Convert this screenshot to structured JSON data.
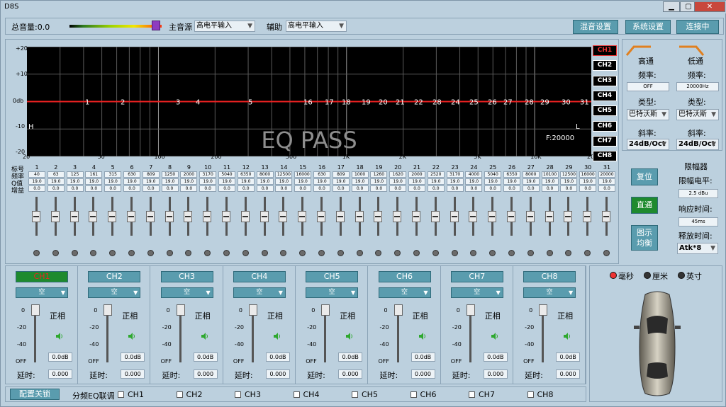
{
  "window": {
    "title": "D8S",
    "min": "▁",
    "max": "▢",
    "close": "✕"
  },
  "top": {
    "master_volume_label": "总音量:0.0",
    "main_source_label": "主音源",
    "main_source_value": "高电平输入",
    "aux_label": "辅助",
    "aux_value": "高电平输入",
    "buttons": [
      "混音设置",
      "系统设置",
      "连接中"
    ]
  },
  "eq": {
    "y_labels": [
      "+20",
      "+10",
      "0db",
      "-10",
      "-20"
    ],
    "x_labels": [
      "20",
      "50",
      "100",
      "200",
      "500",
      "1K",
      "2K",
      "5K",
      "10K",
      "20K"
    ],
    "band_markers": [
      "1",
      "2",
      "3",
      "4",
      "5",
      "16",
      "17",
      "18",
      "19",
      "20",
      "21",
      "22",
      "28",
      "24",
      "25",
      "26",
      "27",
      "28",
      "29",
      "30",
      "31"
    ],
    "overlay_text": "EQ PASS",
    "freq_readout": "F:20000",
    "h_marker": "H",
    "l_marker": "L",
    "channel_buttons": [
      "CH1",
      "CH2",
      "CH3",
      "CH4",
      "CH5",
      "CH6",
      "CH7",
      "CH8"
    ],
    "active_channel": "CH1"
  },
  "bands": {
    "row_labels": [
      "标号",
      "频率",
      "Q值",
      "增益"
    ],
    "numbers": [
      "1",
      "2",
      "3",
      "4",
      "5",
      "6",
      "7",
      "8",
      "9",
      "10",
      "11",
      "12",
      "13",
      "14",
      "15",
      "16",
      "17",
      "18",
      "19",
      "20",
      "21",
      "22",
      "23",
      "24",
      "25",
      "26",
      "27",
      "28",
      "29",
      "30",
      "31"
    ],
    "freqs": [
      "40",
      "63",
      "125",
      "161",
      "315",
      "630",
      "809",
      "1250",
      "2000",
      "3170",
      "5040",
      "6350",
      "8000",
      "12500",
      "16000",
      "630",
      "809",
      "1000",
      "1260",
      "1620",
      "2000",
      "2520",
      "3170",
      "4000",
      "5040",
      "6350",
      "8000",
      "10100",
      "12500",
      "16000",
      "20000"
    ],
    "q": "19.0",
    "gain": "0.0"
  },
  "side_buttons": {
    "reset": "复位",
    "bypass": "直通",
    "graphic_eq": "图示\n均衡"
  },
  "crossover": {
    "hp_title": "高通",
    "lp_title": "低通",
    "freq_label": "频率:",
    "hp_freq": "OFF",
    "lp_freq": "20000Hz",
    "type_label": "类型:",
    "hp_type": "巴特沃斯",
    "lp_type": "巴特沃斯",
    "slope_label": "斜率:",
    "hp_slope": "24dB/Oct",
    "lp_slope": "24dB/Oct"
  },
  "limiter": {
    "title": "限幅器",
    "level_label": "限幅电平:",
    "level_value": "2.5 dBu",
    "attack_label": "响应时间:",
    "attack_value": "45ms",
    "release_label": "释放时间:",
    "release_value": "Atk*8"
  },
  "channels": [
    {
      "name": "CH1",
      "mode": "空",
      "phase": "正相",
      "gain": "0.0dB",
      "delay_label": "延时:",
      "delay": "0.000"
    },
    {
      "name": "CH2",
      "mode": "空",
      "phase": "正相",
      "gain": "0.0dB",
      "delay_label": "延时:",
      "delay": "0.000"
    },
    {
      "name": "CH3",
      "mode": "空",
      "phase": "正相",
      "gain": "0.0dB",
      "delay_label": "延时:",
      "delay": "0.000"
    },
    {
      "name": "CH4",
      "mode": "空",
      "phase": "正相",
      "gain": "0.0dB",
      "delay_label": "延时:",
      "delay": "0.000"
    },
    {
      "name": "CH5",
      "mode": "空",
      "phase": "正相",
      "gain": "0.0dB",
      "delay_label": "延时:",
      "delay": "0.000"
    },
    {
      "name": "CH6",
      "mode": "空",
      "phase": "正相",
      "gain": "0.0dB",
      "delay_label": "延时:",
      "delay": "0.000"
    },
    {
      "name": "CH7",
      "mode": "空",
      "phase": "正相",
      "gain": "0.0dB",
      "delay_label": "延时:",
      "delay": "0.000"
    },
    {
      "name": "CH8",
      "mode": "空",
      "phase": "正相",
      "gain": "0.0dB",
      "delay_label": "延时:",
      "delay": "0.000"
    }
  ],
  "vol_scale": [
    "0",
    "-20",
    "-40",
    "OFF"
  ],
  "bottom": {
    "lock_button": "配置关锁",
    "eq_link_label": "分频EQ联调",
    "checks": [
      "CH1",
      "CH2",
      "CH3",
      "CH4",
      "CH5",
      "CH6",
      "CH7",
      "CH8"
    ]
  },
  "units": {
    "options": [
      "毫秒",
      "厘米",
      "英寸"
    ],
    "selected": "毫秒"
  }
}
